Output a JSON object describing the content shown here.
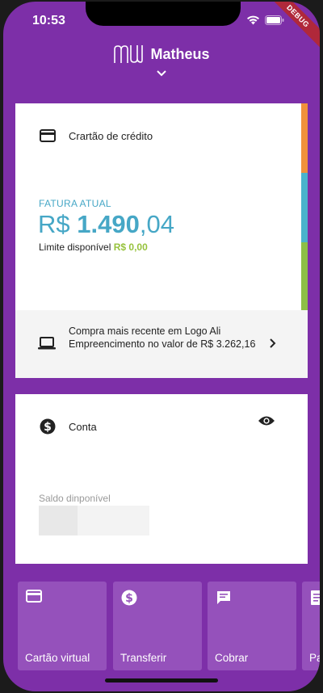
{
  "status": {
    "time": "10:53",
    "debug_label": "DEBUG"
  },
  "header": {
    "user_name": "Matheus"
  },
  "credit_card": {
    "title": "Crartão de crédito",
    "fatura_label": "FATURA ATUAL",
    "currency": "R$",
    "amount_int": "1.490",
    "amount_dec": ",04",
    "limite_label": "Limite disponível",
    "limite_value": "R$ 0,00",
    "recent_purchase": "Compra mais recente em Logo Ali Empreencimento no valor de R$ 3.262,16",
    "bar_colors": [
      "#f0913a",
      "#49b3cc",
      "#8dbf46"
    ]
  },
  "account": {
    "title": "Conta",
    "saldo_label": "Saldo dinponível"
  },
  "shortcuts": [
    {
      "label": "Cartão virtual",
      "icon": "credit-card-icon"
    },
    {
      "label": "Transferir",
      "icon": "dollar-icon"
    },
    {
      "label": "Cobrar",
      "icon": "chat-icon"
    },
    {
      "label": "Pa",
      "icon": "document-icon"
    }
  ],
  "colors": {
    "brand_purple": "#7d2fa8",
    "shortcut_purple": "#9551bb",
    "accent_blue": "#46a7c6",
    "accent_green": "#96c23c"
  }
}
